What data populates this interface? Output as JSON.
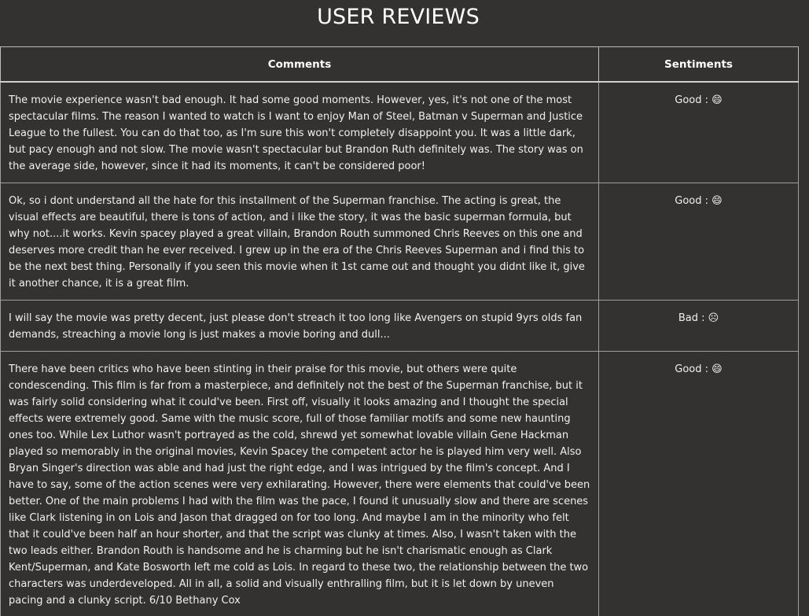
{
  "page": {
    "title": "USER REVIEWS"
  },
  "table": {
    "columns": [
      "Comments",
      "Sentiments"
    ],
    "rows": [
      {
        "comment": "The movie experience wasn't bad enough. It had some good moments. However, yes, it's not one of the most spectacular films. The reason I wanted to watch is I want to enjoy Man of Steel, Batman v Superman and Justice League to the fullest. You can do that too, as I'm sure this won't completely disappoint you. It was a little dark, but pacy enough and not slow. The movie wasn't spectacular but Brandon Ruth definitely was. The story was on the average side, however, since it had its moments, it can't be considered poor!",
        "sentiment": "Good : 😄"
      },
      {
        "comment": "Ok, so i dont understand all the hate for this installment of the Superman franchise. The acting is great, the visual effects are beautiful, there is tons of action, and i like the story, it was the basic superman formula, but why not....it works. Kevin spacey played a great villain, Brandon Routh summoned Chris Reeves on this one and deserves more credit than he ever received. I grew up in the era of the Chris Reeves Superman and i find this to be the next best thing. Personally if you seen this movie when it 1st came out and thought you didnt like it, give it another chance, it is a great film.",
        "sentiment": "Good : 😄"
      },
      {
        "comment": "I will say the movie was pretty decent, just please don't streach it too long like Avengers on stupid 9yrs olds fan demands, streaching a movie long is just makes a movie boring and dull...",
        "sentiment": "Bad : ☹"
      },
      {
        "comment": "There have been critics who have been stinting in their praise for this movie, but others were quite condescending. This film is far from a masterpiece, and definitely not the best of the Superman franchise, but it was fairly solid considering what it could've been. First off, visually it looks amazing and I thought the special effects were extremely good. Same with the music score, full of those familiar motifs and some new haunting ones too. While Lex Luthor wasn't portrayed as the cold, shrewd yet somewhat lovable villain Gene Hackman played so memorably in the original movies, Kevin Spacey the competent actor he is played him very well. Also Bryan Singer's direction was able and had just the right edge, and I was intrigued by the film's concept. And I have to say, some of the action scenes were very exhilarating. However, there were elements that could've been better. One of the main problems I had with the film was the pace, I found it unusually slow and there are scenes like Clark listening in on Lois and Jason that dragged on for too long. And maybe I am in the minority who felt that it could've been half an hour shorter, and that the script was clunky at times. Also, I wasn't taken with the two leads either. Brandon Routh is handsome and he is charming but he isn't charismatic enough as Clark Kent/Superman, and Kate Bosworth left me cold as Lois. In regard to these two, the relationship between the two characters was underdeveloped. All in all, a solid and visually enthralling film, but it is let down by uneven pacing and a clunky script. 6/10 Bethany Cox",
        "sentiment": "Good : 😄"
      }
    ]
  }
}
